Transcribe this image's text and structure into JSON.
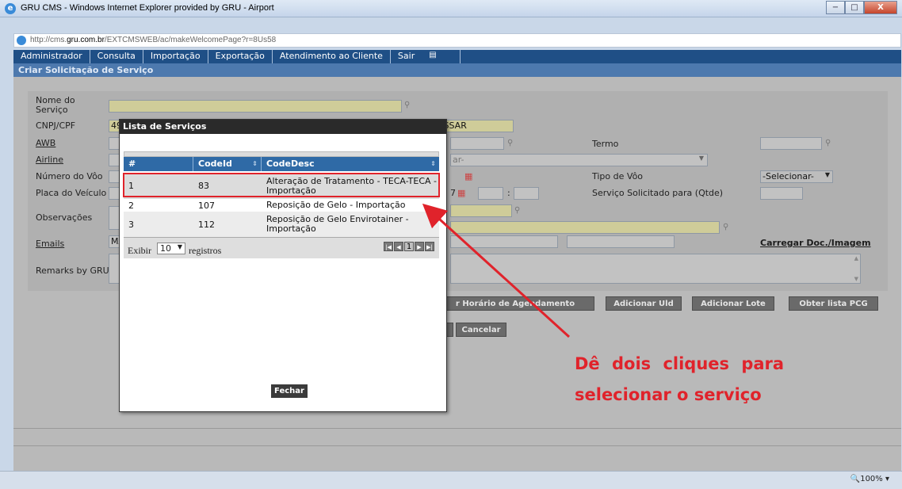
{
  "window": {
    "title": "GRU CMS - Windows Internet Explorer provided by GRU - Airport",
    "url_prefix": "http://cms.",
    "url_domain": "gru.com.br",
    "url_path": "/EXTCMSWEB/ac/makeWelcomePage?r=8Us58",
    "min": "−",
    "max": "□",
    "close": "X"
  },
  "menu": {
    "items": [
      "Administrador",
      "Consulta",
      "Importação",
      "Exportação",
      "Atendimento ao Cliente",
      "Sair"
    ]
  },
  "subtitle": "Criar Solicitação de Serviço",
  "form": {
    "nome_servico": "Nome do\nServiço",
    "cnpj": "CNPJ/CPF",
    "cnpj_value": "49",
    "cnpj_suffix": "SE COMISSAR",
    "awb": "AWB",
    "airline": "Airline",
    "airline_placeholder": "ar-",
    "numero_voo": "Número do Vôo",
    "placa": "Placa do Veículo",
    "placa_date": "7",
    "observacoes": "Observações",
    "emails": "Emails",
    "emails_value": "MA",
    "remarks": "Remarks by GRU",
    "termo": "Termo",
    "tipo_voo": "Tipo de Vôo",
    "tipo_voo_value": "-Selecionar-",
    "servico_qtde": "Serviço Solicitado para (Qtde)",
    "carregar": "Carregar Doc./Imagem",
    "colon": ":"
  },
  "buttons": {
    "horario": "r Horário de Agendamento",
    "uld": "Adicionar Uld",
    "lote": "Adicionar Lote",
    "pcg": "Obter lista PCG",
    "cancelar": "Cancelar"
  },
  "modal": {
    "title": "Lista de Serviços",
    "columns": [
      "#",
      "CodeId",
      "CodeDesc"
    ],
    "rows": [
      {
        "n": "1",
        "id": "83",
        "desc": "Alteração de Tratamento - TECA-TECA - Importação"
      },
      {
        "n": "2",
        "id": "107",
        "desc": "Reposição de Gelo - Importação"
      },
      {
        "n": "3",
        "id": "112",
        "desc": "Reposição de Gelo Envirotainer - Importação"
      }
    ],
    "exibir": "Exibir",
    "page_size": "10",
    "registros": "registros",
    "page": "1",
    "close": "Fechar"
  },
  "annotation": {
    "line1": "Dê dois cliques para",
    "line2": "selecionar o serviço",
    "color": "#e0232b"
  },
  "status": {
    "zoom": "100%"
  }
}
